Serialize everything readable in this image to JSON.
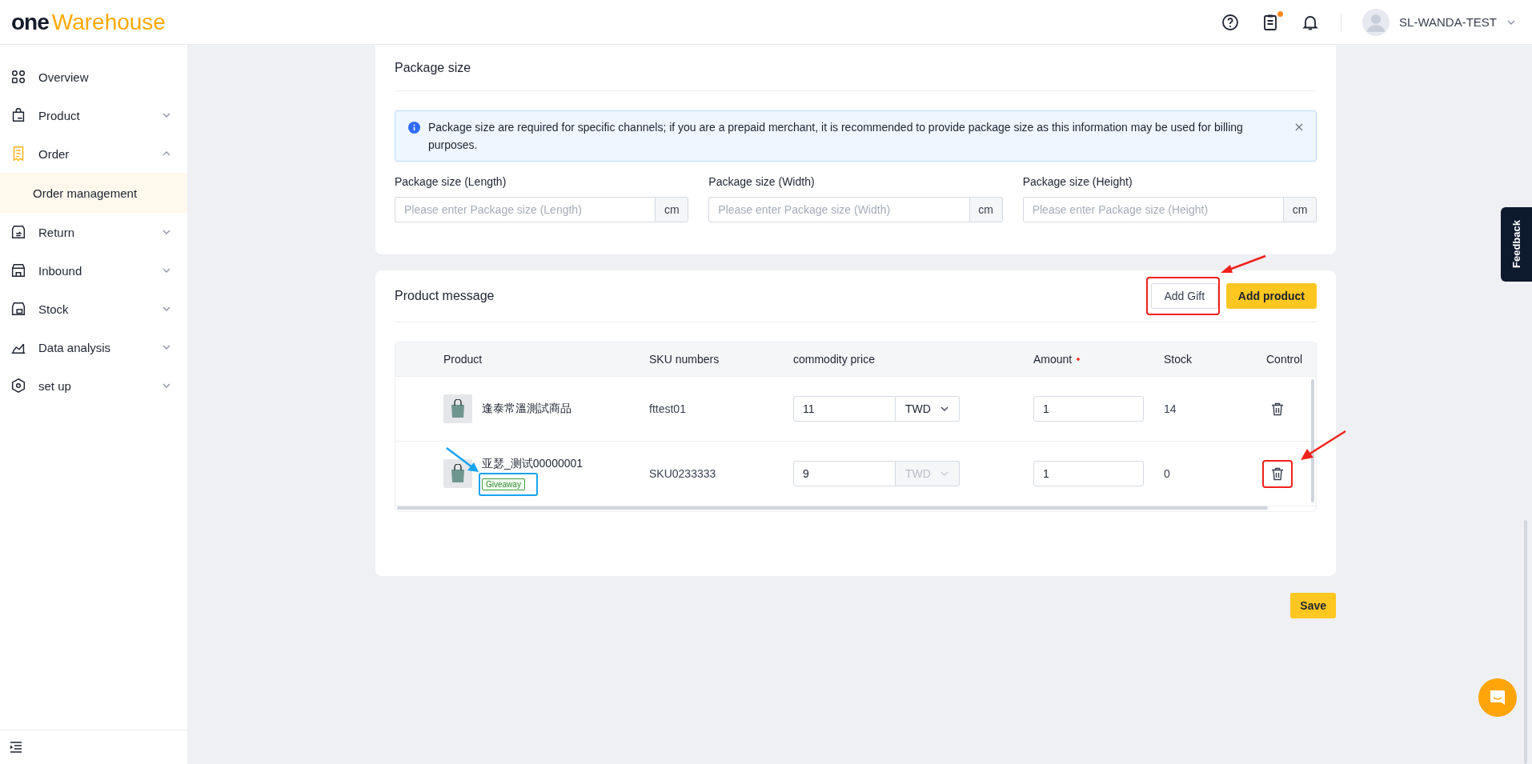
{
  "header": {
    "logo": {
      "prefix": "one",
      "name": "Warehouse"
    },
    "clipboard_has_notification": true,
    "user": "SL-WANDA-TEST"
  },
  "sidebar": {
    "items": [
      {
        "label": "Overview",
        "kind": "link",
        "selected": false
      },
      {
        "label": "Product",
        "kind": "group",
        "expanded": false,
        "selected": false
      },
      {
        "label": "Order",
        "kind": "group",
        "expanded": true,
        "selected": true,
        "children": [
          {
            "label": "Order management",
            "selected": true
          }
        ]
      },
      {
        "label": "Return",
        "kind": "group",
        "expanded": false,
        "selected": false
      },
      {
        "label": "Inbound",
        "kind": "group",
        "expanded": false,
        "selected": false
      },
      {
        "label": "Stock",
        "kind": "group",
        "expanded": false,
        "selected": false
      },
      {
        "label": "Data analysis",
        "kind": "group",
        "expanded": false,
        "selected": false
      },
      {
        "label": "set up",
        "kind": "group",
        "expanded": false,
        "selected": false
      }
    ]
  },
  "package_size": {
    "title": "Package size",
    "alert": "Package size are required for specific channels; if you are a prepaid merchant, it is recommended to provide package size as this information may be used for billing purposes.",
    "fields": [
      {
        "label": "Package size (Length)",
        "placeholder": "Please enter Package size (Length)",
        "unit": "cm"
      },
      {
        "label": "Package size (Width)",
        "placeholder": "Please enter Package size (Width)",
        "unit": "cm"
      },
      {
        "label": "Package size (Height)",
        "placeholder": "Please enter Package size (Height)",
        "unit": "cm"
      }
    ]
  },
  "product_message": {
    "title": "Product message",
    "buttons": [
      {
        "label": "Add Gift",
        "kind": "secondary"
      },
      {
        "label": "Add product",
        "kind": "primary"
      }
    ],
    "table": {
      "columns": [
        {
          "label": "Product",
          "required": false
        },
        {
          "label": "SKU numbers",
          "required": false
        },
        {
          "label": "commodity price",
          "required": false
        },
        {
          "label": "Amount",
          "required": true
        },
        {
          "label": "Stock",
          "required": false
        },
        {
          "label": "Control",
          "required": false
        }
      ],
      "rows": [
        {
          "name": "逢泰常溫測試商品",
          "sku": "fttest01",
          "price": "11",
          "currency": "TWD",
          "currency_disabled": false,
          "amount": "1",
          "stock": "14"
        },
        {
          "name": "亚瑟_测试00000001",
          "tag": "Giveaway",
          "sku": "SKU0233333",
          "price": "9",
          "currency": "TWD",
          "currency_disabled": true,
          "amount": "1",
          "stock": "0"
        }
      ]
    }
  },
  "save_button": "Save",
  "feedback_tab": "Feedback"
}
